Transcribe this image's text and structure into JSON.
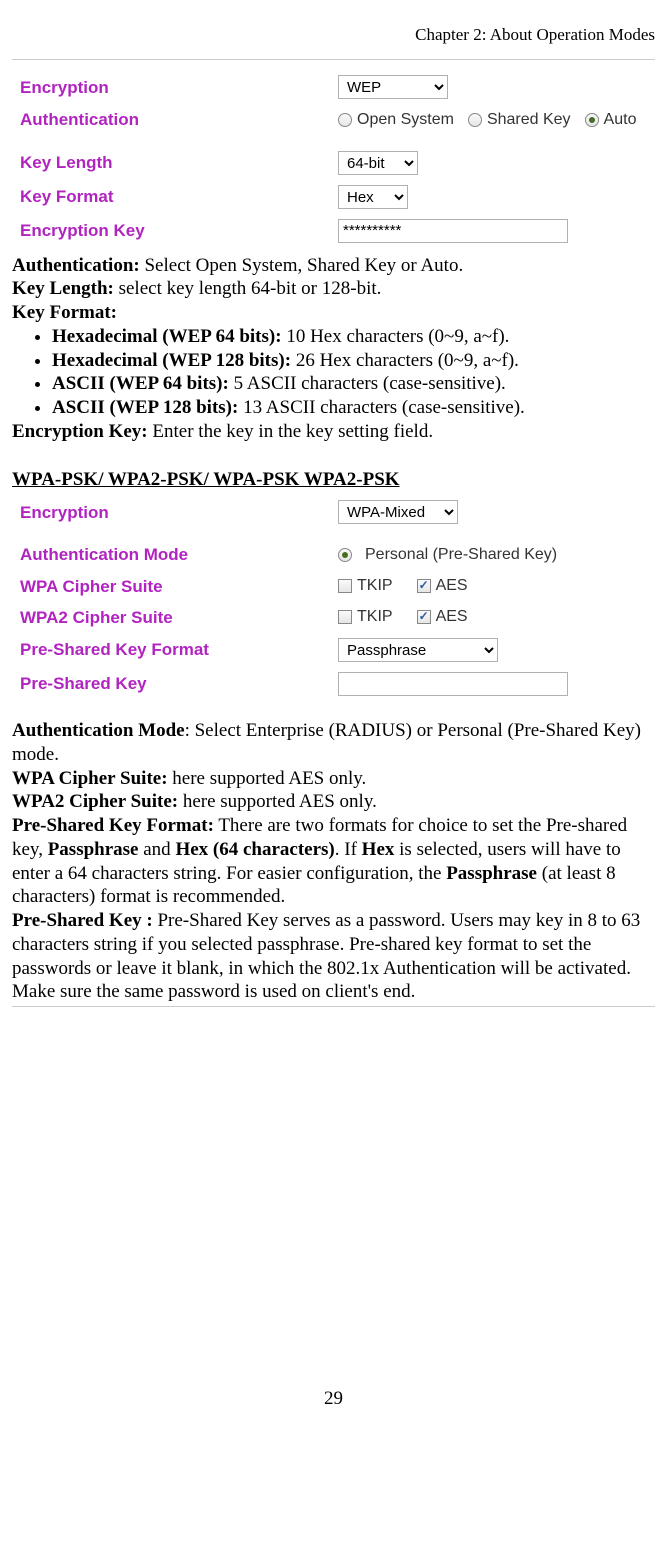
{
  "header": "Chapter 2: About Operation Modes",
  "panel1": {
    "rows": {
      "encryption": {
        "label": "Encryption",
        "value": "WEP"
      },
      "authentication": {
        "label": "Authentication",
        "opts": {
          "open": "Open System",
          "shared": "Shared Key",
          "auto": "Auto"
        }
      },
      "keyLength": {
        "label": "Key Length",
        "value": "64-bit"
      },
      "keyFormat": {
        "label": "Key Format",
        "value": "Hex"
      },
      "encryptionKey": {
        "label": "Encryption Key",
        "value": "**********"
      }
    }
  },
  "prose1": {
    "auth_label": "Authentication:",
    "auth_text": " Select Open System, Shared Key or Auto.",
    "keylen_label": "Key Length:",
    "keylen_text": " select key length 64-bit or 128-bit.",
    "keyfmt_label": "Key Format:",
    "bullets": [
      {
        "b": "Hexadecimal (WEP 64 bits):",
        "t": " 10 Hex characters (0~9, a~f)."
      },
      {
        "b": "Hexadecimal (WEP 128 bits):",
        "t": " 26 Hex characters (0~9, a~f)."
      },
      {
        "b": "ASCII (WEP 64 bits):",
        "t": " 5 ASCII characters (case-sensitive)."
      },
      {
        "b": "ASCII (WEP 128 bits):",
        "t": " 13 ASCII characters (case-sensitive)."
      }
    ],
    "enckey_label": "Encryption Key:",
    "enckey_text": " Enter the key in the key setting field."
  },
  "section2_heading": "WPA-PSK/ WPA2-PSK/ WPA-PSK WPA2-PSK",
  "panel2": {
    "rows": {
      "encryption": {
        "label": "Encryption",
        "value": "WPA-Mixed"
      },
      "authMode": {
        "label": "Authentication Mode",
        "personal": "Personal (Pre-Shared Key)"
      },
      "wpaCipher": {
        "label": "WPA Cipher Suite",
        "tkip": "TKIP",
        "aes": "AES"
      },
      "wpa2Cipher": {
        "label": "WPA2 Cipher Suite",
        "tkip": "TKIP",
        "aes": "AES"
      },
      "pskFormat": {
        "label": "Pre-Shared Key Format",
        "value": "Passphrase"
      },
      "psk": {
        "label": "Pre-Shared Key",
        "value": ""
      }
    }
  },
  "prose2": {
    "authmode_label": "Authentication Mode",
    "authmode_text": ": Select Enterprise (RADIUS) or Personal (Pre-Shared Key) mode.",
    "wpa_label": "WPA Cipher Suite:",
    "wpa_text": " here supported AES only.",
    "wpa2_label": "WPA2 Cipher Suite:",
    "wpa2_text": " here supported AES only.",
    "pskfmt_label": "Pre-Shared Key Format:",
    "pskfmt_t1": "  There are two formats for choice to set the Pre-shared key, ",
    "pskfmt_b1": "Passphrase",
    "pskfmt_t2": " and ",
    "pskfmt_b2": "Hex (64 characters)",
    "pskfmt_t3": ". If ",
    "pskfmt_b3": "Hex",
    "pskfmt_t4": " is selected, users will have to enter a 64 characters string. For easier configuration, the ",
    "pskfmt_b4": "Passphrase",
    "pskfmt_t5": " (at least 8 characters) format is recommended.",
    "psk_label": "Pre-Shared Key :",
    "psk_text": " Pre-Shared Key serves as a password.  Users may key in 8 to 63 characters string if you selected passphrase. Pre-shared key format to set the passwords or leave it blank, in which the 802.1x Authentication will be activated.  Make sure the same password is used on client's end."
  },
  "page_number": "29"
}
